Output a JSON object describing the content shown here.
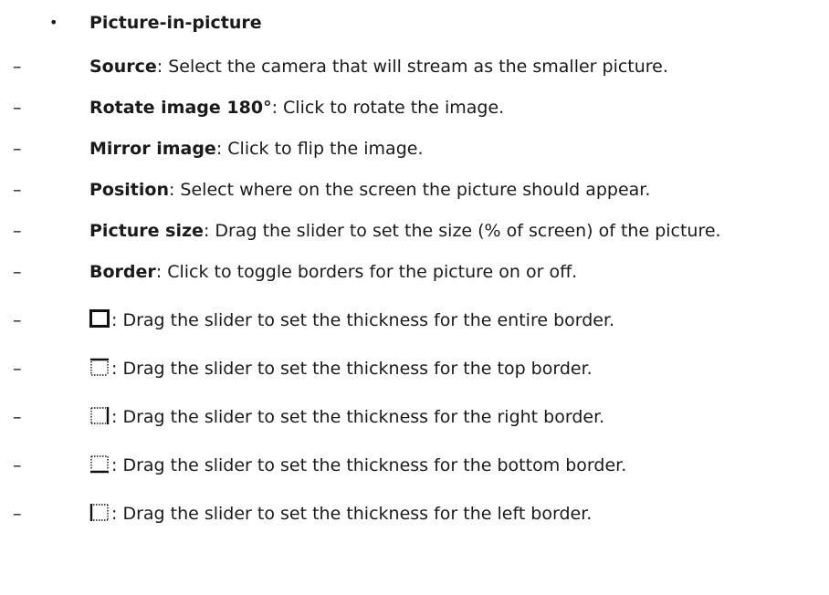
{
  "section": {
    "bullet": "•",
    "heading": "Picture-in-picture"
  },
  "items": [
    {
      "dash": "–",
      "term": "Source",
      "desc": ": Select the camera that will stream as the smaller picture."
    },
    {
      "dash": "–",
      "term": "Rotate image 180°",
      "desc": ": Click to rotate the image."
    },
    {
      "dash": "–",
      "term": "Mirror image",
      "desc": ": Click to flip the image."
    },
    {
      "dash": "–",
      "term": "Position",
      "desc": ": Select where on the screen the picture should appear."
    },
    {
      "dash": "–",
      "term": "Picture size",
      "desc": ": Drag the slider to set the size (% of screen) of the picture."
    },
    {
      "dash": "–",
      "term": "Border",
      "desc": ": Click to toggle borders for the picture on or off."
    }
  ],
  "border_items": [
    {
      "dash": "–",
      "icon": "border-all-icon",
      "desc": ": Drag the slider to set the thickness for the entire border."
    },
    {
      "dash": "–",
      "icon": "border-top-icon",
      "desc": ": Drag the slider to set the thickness for the top border."
    },
    {
      "dash": "–",
      "icon": "border-right-icon",
      "desc": ": Drag the slider to set the thickness for the right border."
    },
    {
      "dash": "–",
      "icon": "border-bottom-icon",
      "desc": ": Drag the slider to set the thickness for the bottom border."
    },
    {
      "dash": "–",
      "icon": "border-left-icon",
      "desc": ": Drag the slider to set the thickness for the left border."
    }
  ]
}
